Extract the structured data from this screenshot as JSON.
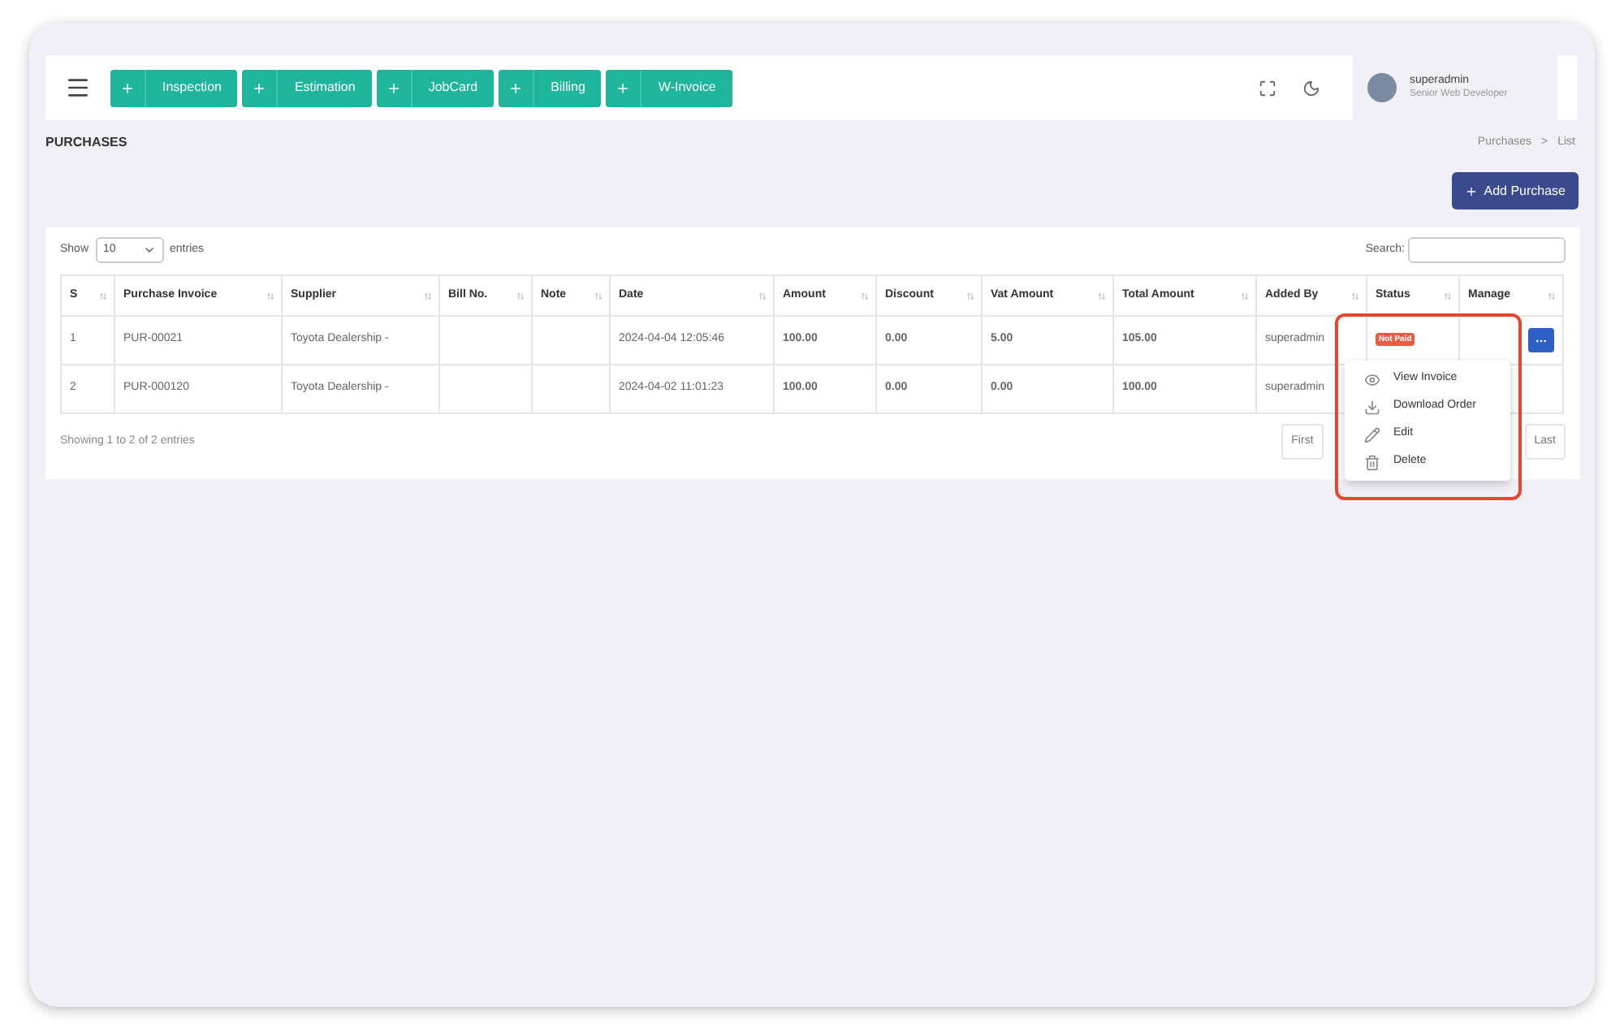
{
  "quick_actions": [
    {
      "label": "Inspection"
    },
    {
      "label": "Estimation"
    },
    {
      "label": "JobCard"
    },
    {
      "label": "Billing"
    },
    {
      "label": "W-Invoice"
    }
  ],
  "user": {
    "name": "superadmin",
    "role": "Senior Web Developer"
  },
  "page_title": "PURCHASES",
  "breadcrumb": {
    "items": [
      "Purchases",
      "List"
    ],
    "separator": ">"
  },
  "add_button": "Add Purchase",
  "show_entries": {
    "prefix": "Show",
    "value": "10",
    "suffix": "entries"
  },
  "search": {
    "label": "Search:"
  },
  "table": {
    "columns": [
      "S",
      "Purchase Invoice",
      "Supplier",
      "Bill No.",
      "Note",
      "Date",
      "Amount",
      "Discount",
      "Vat Amount",
      "Total Amount",
      "Added By",
      "Status",
      "Manage"
    ],
    "rows": [
      {
        "cells": [
          "1",
          "PUR-00021",
          "Toyota Dealership -",
          "",
          "",
          "2024-04-04 12:05:46",
          "100.00",
          "0.00",
          "5.00",
          "105.00",
          "superadmin"
        ],
        "status": "Not Paid"
      },
      {
        "cells": [
          "2",
          "PUR-000120",
          "Toyota Dealership -",
          "",
          "",
          "2024-04-02 11:01:23",
          "100.00",
          "0.00",
          "0.00",
          "100.00",
          "superadmin"
        ]
      }
    ]
  },
  "info": "Showing 1 to 2 of 2 entries",
  "pagination": [
    "First",
    "Last"
  ],
  "action_menu": [
    {
      "label": "View Invoice",
      "kind": "view"
    },
    {
      "label": "Download Order",
      "kind": "download"
    },
    {
      "label": "Edit",
      "kind": "edit"
    },
    {
      "label": "Delete",
      "kind": "delete"
    }
  ]
}
